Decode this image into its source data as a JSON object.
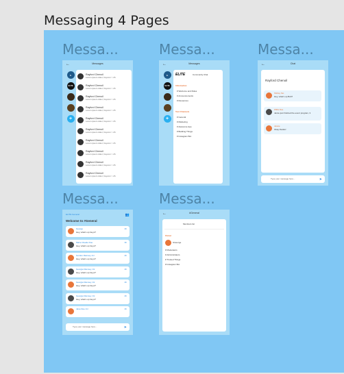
{
  "title": "Messaging 4 Pages",
  "frames": [
    {
      "label": "Messa..."
    },
    {
      "label": "Messa..."
    },
    {
      "label": "Messa..."
    },
    {
      "label": "Messa..."
    },
    {
      "label": "Messa..."
    }
  ],
  "f1": {
    "header": "Messages",
    "rail": [
      "",
      "ELITE",
      "",
      "",
      "+"
    ],
    "rows": [
      {
        "name": "Rayford Chenoil",
        "preview": "Lorem ipsum dolor, heycom > 2h"
      },
      {
        "name": "Rayford Chenoil",
        "preview": "Lorem ipsum dolor, heycom > 2h"
      },
      {
        "name": "Rayford Chenoil",
        "preview": "Lorem ipsum dolor, heycom > 2h"
      },
      {
        "name": "Rayford Chenoil",
        "preview": "Lorem ipsum dolor, heycom > 2h"
      },
      {
        "name": "Rayford Chenoil",
        "preview": "Lorem ipsum dolor, heycom > 2h"
      },
      {
        "name": "Rayford Chenoil",
        "preview": "Lorem ipsum dolor, heycom > 2h"
      },
      {
        "name": "Rayford Chenoil",
        "preview": "Lorem ipsum dolor, heycom > 2h"
      },
      {
        "name": "Rayford Chenoil",
        "preview": "Lorem ipsum dolor, heycom > 2h"
      },
      {
        "name": "Rayford Chenoil",
        "preview": "Lorem ipsum dolor, heycom > 2h"
      },
      {
        "name": "Rayford Chenoil",
        "preview": "Lorem ipsum dolor, heycom > 2h"
      }
    ]
  },
  "f2": {
    "header": "Messages",
    "logo": "ELITE",
    "community": "Community Chat",
    "section1": "Information",
    "items1": [
      "# Welcome and Rules",
      "# Announcements",
      "# Resources"
    ],
    "section2": "Text Channels",
    "items2": [
      "# General",
      "# Marketing",
      "# Awesome App",
      "# Building Things",
      "# Instagram Bot"
    ]
  },
  "f3": {
    "header": "Chat",
    "name": "Rayford Chenoil",
    "messages": [
      {
        "name": "Shirley Sio",
        "text": "Hey, what's up Bob?"
      },
      {
        "name": "Willis Doe",
        "text": "Jamie just finished the event program, 3"
      },
      {
        "name": "Jessie",
        "text": "Okay thanks!"
      }
    ],
    "input": "Type your message here..."
  },
  "f4": {
    "server": "ELITE General",
    "welcome": "Welcome to #General",
    "messages": [
      {
        "name": "George",
        "text": "Hey, what's up Guys?",
        "time": "2h"
      },
      {
        "name": "Marie Claude Doe",
        "text": "Hey, what's up Guys?",
        "time": "3h"
      },
      {
        "name": "Gordon Ramsey Jnr",
        "text": "Hey, what's up Guys?",
        "time": "4h"
      },
      {
        "name": "Georgie Ramsey Jnr",
        "text": "Hey, what's up Guys?",
        "time": "4h"
      },
      {
        "name": "Georgie Ramsey Jnr",
        "text": "Hey, what's up Guys?",
        "time": "4h"
      },
      {
        "name": "Georgie Ramsey Jnr",
        "text": "Hey, what's up Guys?",
        "time": "4h"
      },
      {
        "name": "Jane Doe Jnr",
        "text": "",
        "time": "4h"
      }
    ],
    "input": "Type your message here..."
  },
  "f5": {
    "header": "#General",
    "members": "Members list",
    "role": "Owner",
    "owner": "GGeorge",
    "items": [
      "# Moderators",
      "# Administrators",
      "# Trusted Things",
      "# Instagram Bot"
    ]
  },
  "colors": {
    "canvas": "#80c7f4",
    "frame": "#a9dcf7",
    "accent": "#2a8be0"
  }
}
